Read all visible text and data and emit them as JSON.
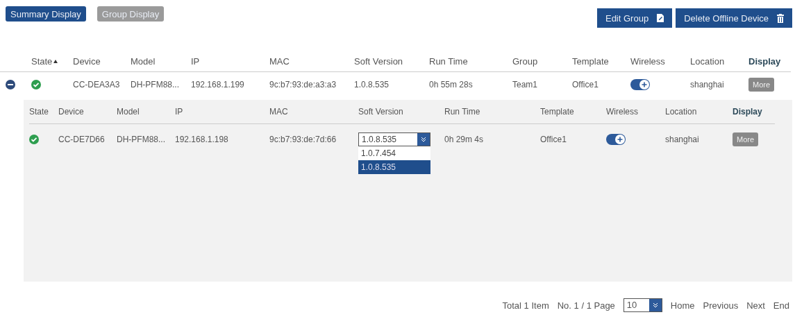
{
  "view_tabs": [
    {
      "label": "Summary Display",
      "selected": true
    },
    {
      "label": "Group Display",
      "selected": false
    }
  ],
  "actions": [
    {
      "label": "Edit Group"
    },
    {
      "label": "Delete Offline Device"
    }
  ],
  "table": {
    "columns": [
      {
        "label": "State",
        "sort_ascending": true
      },
      {
        "label": "Device"
      },
      {
        "label": "Model"
      },
      {
        "label": "IP"
      },
      {
        "label": "MAC"
      },
      {
        "label": "Soft Version"
      },
      {
        "label": "Run Time"
      },
      {
        "label": "Group"
      },
      {
        "label": "Template"
      },
      {
        "label": "Wireless"
      },
      {
        "label": "Location"
      },
      {
        "label": "Display",
        "emphasis": true
      }
    ],
    "rows": [
      {
        "expanded": true,
        "online": true,
        "device": "CC-DEA3A3",
        "model": "DH-PFM88...",
        "ip": "192.168.1.199",
        "mac": "9c:b7:93:de:a3:a3",
        "soft_version": "1.0.8.535",
        "run_time": "0h 55m 28s",
        "group": "Team1",
        "template": "Office1",
        "wireless_on": true,
        "location": "shanghai",
        "display_button": "More",
        "detail": {
          "columns": [
            {
              "label": "State"
            },
            {
              "label": "Device"
            },
            {
              "label": "Model"
            },
            {
              "label": "IP"
            },
            {
              "label": "MAC"
            },
            {
              "label": "Soft Version"
            },
            {
              "label": "Run Time"
            },
            {
              "label": "Template"
            },
            {
              "label": "Wireless"
            },
            {
              "label": "Location"
            },
            {
              "label": "Display",
              "emphasis": true
            }
          ],
          "rows": [
            {
              "online": true,
              "device": "CC-DE7D66",
              "model": "DH-PFM88...",
              "ip": "192.168.1.198",
              "mac": "9c:b7:93:de:7d:66",
              "soft_version": {
                "value": "1.0.8.535",
                "open": true,
                "options": [
                  {
                    "label": "1.0.7.454",
                    "selected": false
                  },
                  {
                    "label": "1.0.8.535",
                    "selected": true
                  }
                ]
              },
              "run_time": "0h 29m 4s",
              "template": "Office1",
              "wireless_on": true,
              "location": "shanghai",
              "display_button": "More"
            }
          ]
        }
      }
    ]
  },
  "pagination": {
    "total": "Total 1 Item",
    "page": "No. 1 / 1 Page",
    "page_size": "10",
    "links": [
      "Home",
      "Previous",
      "Next",
      "End"
    ]
  }
}
